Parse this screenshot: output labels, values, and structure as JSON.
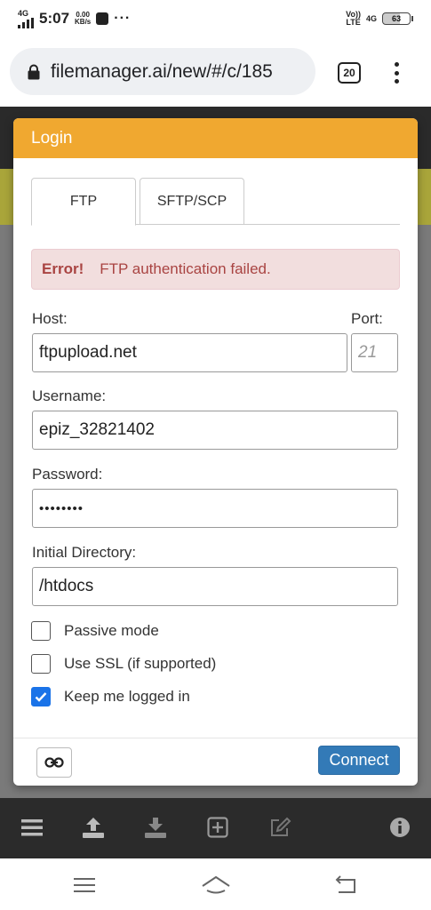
{
  "status_bar": {
    "network": "4G",
    "time": "5:07",
    "speed_value": "0.00",
    "speed_unit": "KB/s",
    "overflow": "···",
    "volte_top": "Vo))",
    "volte_bottom": "LTE",
    "network_right": "4G",
    "battery": "63"
  },
  "browser": {
    "url": "filemanager.ai/new/#/c/185",
    "tab_count": "20",
    "icons": [
      "lock-icon",
      "tabs-icon",
      "more-vert-icon"
    ]
  },
  "modal": {
    "title": "Login",
    "header_color": "#f0a830",
    "tabs": [
      {
        "label": "FTP",
        "active": true
      },
      {
        "label": "SFTP/SCP",
        "active": false
      }
    ],
    "error": {
      "title": "Error!",
      "message": "FTP authentication failed."
    },
    "host": {
      "label": "Host:",
      "value": "ftpupload.net"
    },
    "port": {
      "label": "Port:",
      "placeholder": "21"
    },
    "username": {
      "label": "Username:",
      "value": "epiz_32821402"
    },
    "password": {
      "label": "Password:",
      "value": "••••••••"
    },
    "directory": {
      "label": "Initial Directory:",
      "value": "/htdocs"
    },
    "options": [
      {
        "label": "Passive mode",
        "checked": false
      },
      {
        "label": "Use SSL (if supported)",
        "checked": false
      },
      {
        "label": "Keep me logged in",
        "checked": true
      }
    ],
    "connect_label": "Connect",
    "connect_color": "#337ab7"
  },
  "toolbar": {
    "icons": [
      "menu-icon",
      "upload-icon",
      "download-icon",
      "add-box-icon",
      "edit-icon",
      "info-icon"
    ]
  },
  "navbar": {
    "icons": [
      "recents-icon",
      "home-icon",
      "back-icon"
    ]
  }
}
